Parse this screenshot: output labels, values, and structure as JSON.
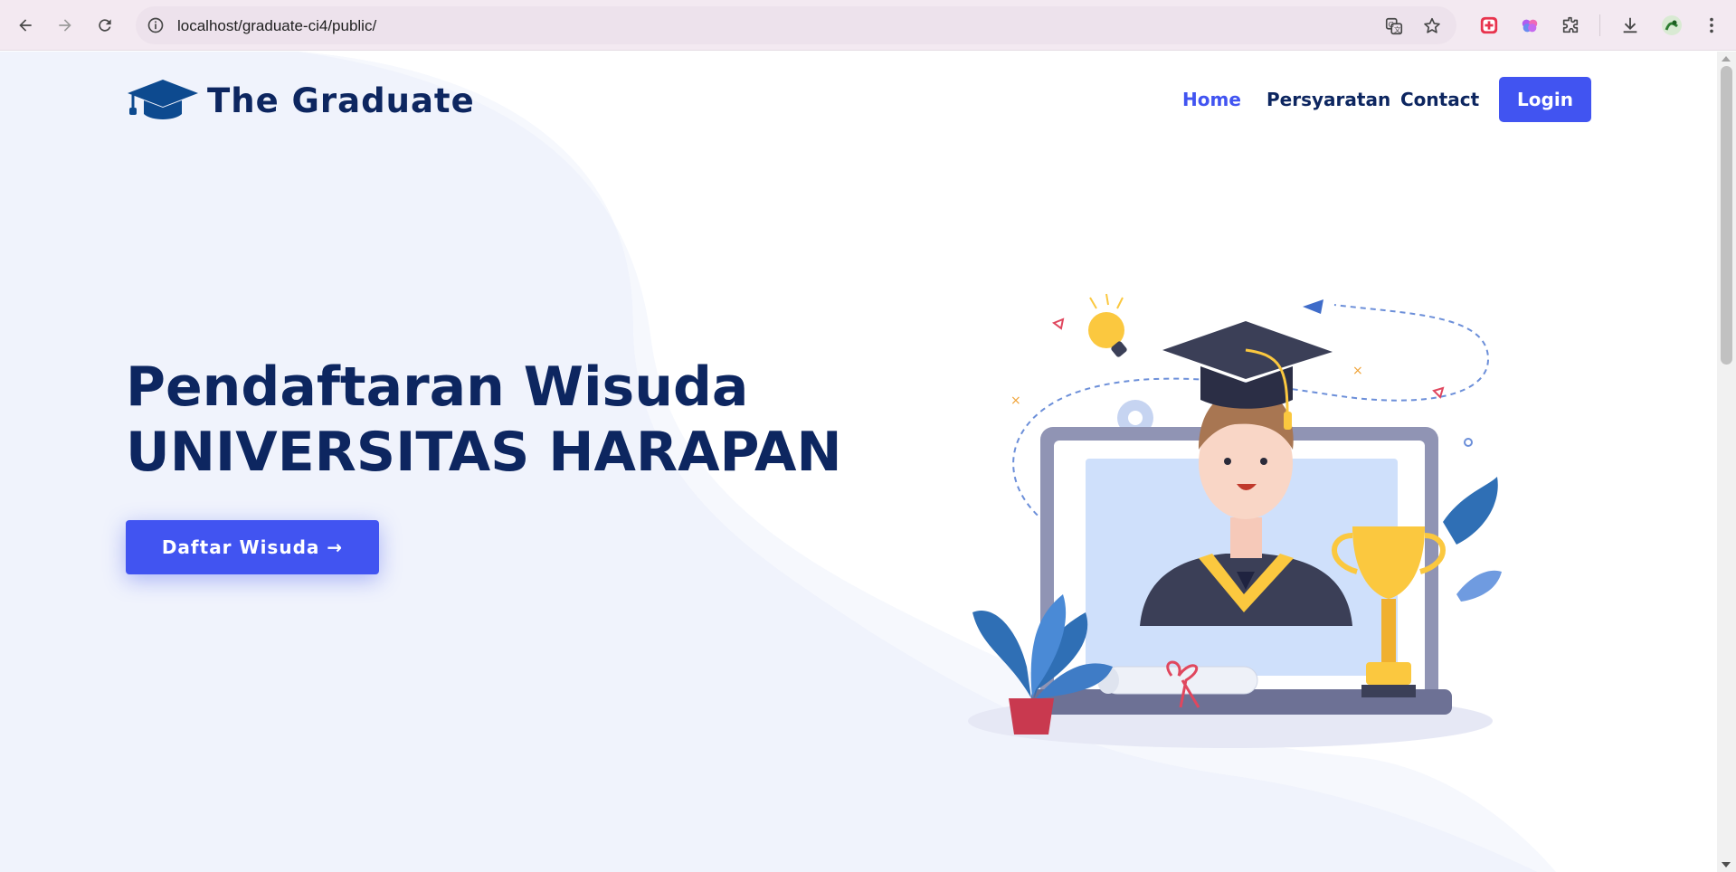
{
  "browser": {
    "url": "localhost/graduate-ci4/public/",
    "icons": [
      "back-icon",
      "forward-icon",
      "reload-icon",
      "site-info-icon",
      "translate-icon",
      "bookmark-star-icon",
      "extension-red-icon",
      "extension-brain-icon",
      "extensions-puzzle-icon",
      "download-icon",
      "profile-avatar",
      "more-menu-icon"
    ]
  },
  "site": {
    "brand": "The Graduate",
    "nav": {
      "home": "Home",
      "persyaratan": "Persyaratan",
      "contact": "Contact",
      "login": "Login"
    },
    "hero": {
      "line1": "Pendaftaran Wisuda",
      "line2": "UNIVERSITAS HARAPAN",
      "cta_label": "Daftar Wisuda",
      "cta_arrow": "→"
    },
    "colors": {
      "primary": "#4154f1",
      "heading": "#0d2660",
      "background_wave": "#f0f3fc"
    },
    "illustration": "graduate-on-laptop-illustration"
  }
}
